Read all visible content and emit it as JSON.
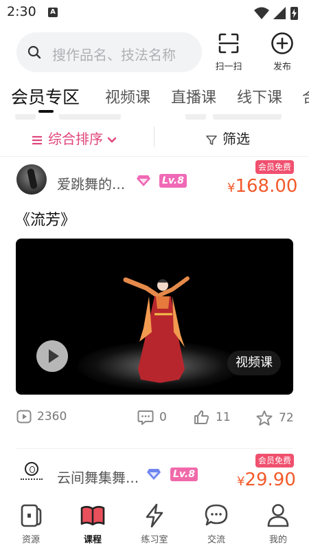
{
  "status_bar": {
    "time": "2:30",
    "indicator_letter": "A"
  },
  "search": {
    "placeholder": "搜作品名、技法名称"
  },
  "top_actions": {
    "scan_label": "扫一扫",
    "publish_label": "发布"
  },
  "tabs": [
    {
      "label": "会员专区",
      "active": true
    },
    {
      "label": "视频课",
      "active": false
    },
    {
      "label": "直播课",
      "active": false
    },
    {
      "label": "线下课",
      "active": false
    },
    {
      "label": "合",
      "active": false
    }
  ],
  "filter": {
    "sort_label": "综合排序",
    "filter_label": "筛选"
  },
  "courses": [
    {
      "author": "爱跳舞的...",
      "level": "Lv.8",
      "vip_tag": "会员免费",
      "currency": "¥",
      "price": "168.00",
      "title": "《流芳》",
      "video_tag": "视频课",
      "views": "2360",
      "comments": "0",
      "likes": "11",
      "favorites": "72"
    },
    {
      "author": "云间舞集舞...",
      "level": "Lv.8",
      "vip_tag": "会员免费",
      "currency": "¥",
      "price": "29.90"
    }
  ],
  "bottom_nav": [
    {
      "label": "资源",
      "icon": "resource-icon",
      "active": false
    },
    {
      "label": "课程",
      "icon": "book-icon",
      "active": true
    },
    {
      "label": "练习室",
      "icon": "lightning-icon",
      "active": false
    },
    {
      "label": "交流",
      "icon": "chat-icon",
      "active": false
    },
    {
      "label": "我的",
      "icon": "person-icon",
      "active": false
    }
  ],
  "colors": {
    "accent_pink": "#e0457b",
    "price_orange": "#f25a2a",
    "vip_tag_bg": "#f0506e",
    "level_badge": "#f069b6"
  }
}
